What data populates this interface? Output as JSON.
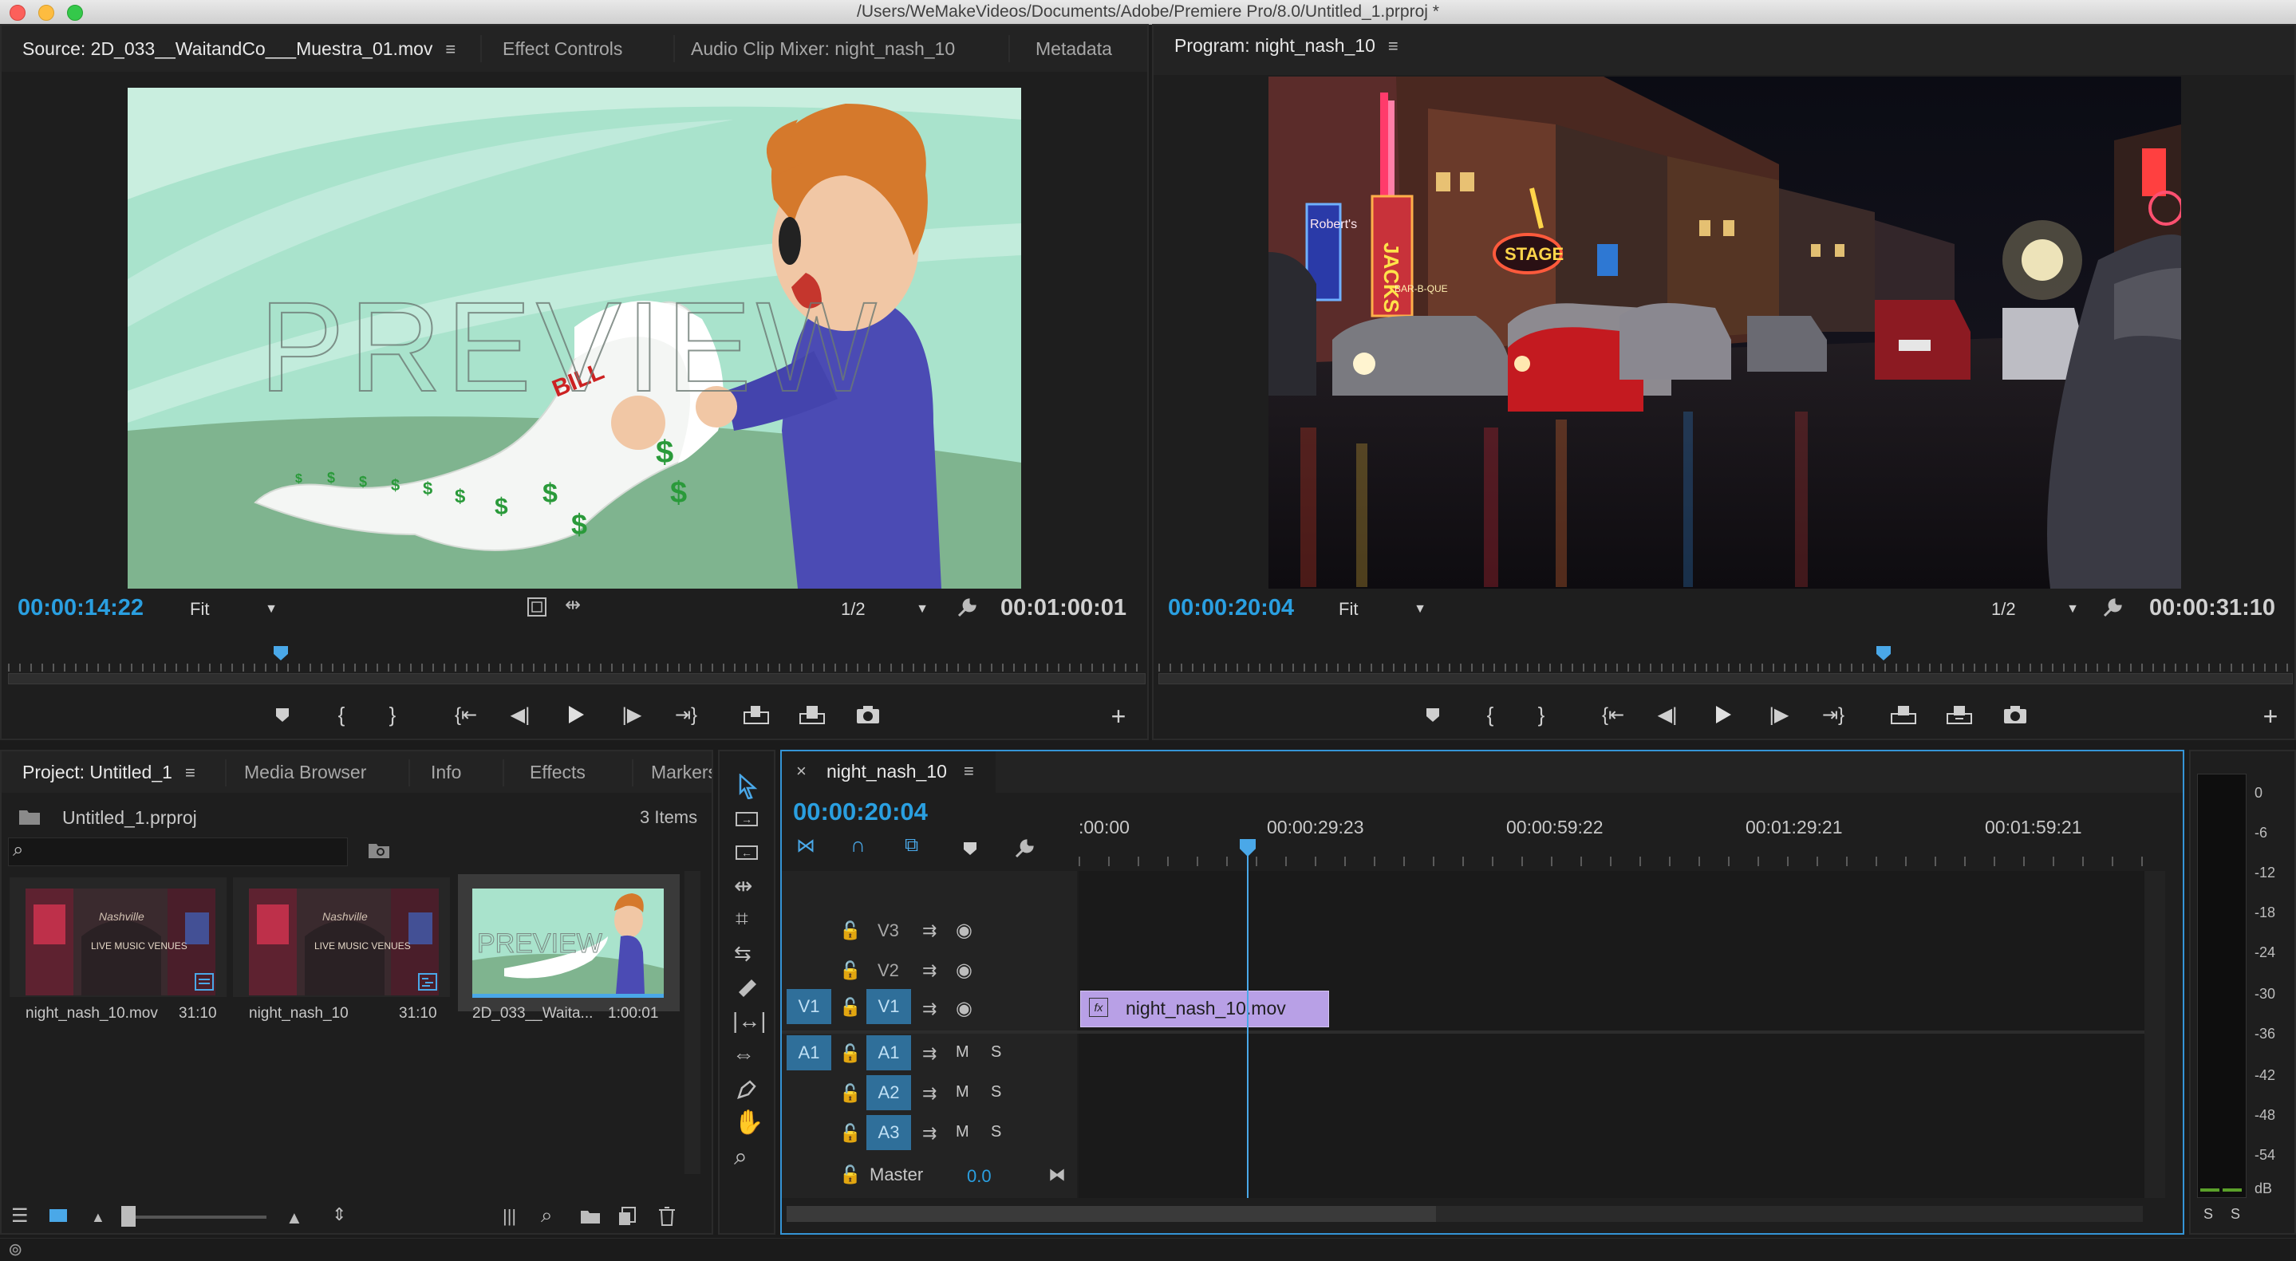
{
  "window": {
    "title": "/Users/WeMakeVideos/Documents/Adobe/Premiere Pro/8.0/Untitled_1.prproj *"
  },
  "source_panel": {
    "tabs": [
      "Source: 2D_033__WaitandCo___Muestra_01.mov",
      "Effect Controls",
      "Audio Clip Mixer: night_nash_10",
      "Metadata"
    ],
    "preview_text": "PREVIEW",
    "bill_text": "BILL",
    "timecode": "00:00:14:22",
    "fit": "Fit",
    "resolution": "1/2",
    "duration": "00:01:00:01",
    "playhead_fraction": 0.24
  },
  "program_panel": {
    "title": "Program: night_nash_10",
    "timecode": "00:00:20:04",
    "fit": "Fit",
    "resolution": "1/2",
    "duration": "00:00:31:10",
    "playhead_fraction": 0.64,
    "sign_text": [
      "JACKS",
      "BAR-B-QUE",
      "STAGE",
      "Robert's"
    ]
  },
  "project_panel": {
    "tabs": [
      "Project: Untitled_1",
      "Media Browser",
      "Info",
      "Effects",
      "Markers"
    ],
    "file": "Untitled_1.prproj",
    "count": "3 Items",
    "thumb_sign": "LIVE MUSIC VENUES",
    "thumb_script": "Nashville",
    "items": [
      {
        "name": "night_nash_10.mov",
        "duration": "31:10"
      },
      {
        "name": "night_nash_10",
        "duration": "31:10"
      },
      {
        "name": "2D_033__Waita...",
        "duration": "1:00:01"
      }
    ]
  },
  "timeline": {
    "tab": "night_nash_10",
    "timecode": "00:00:20:04",
    "ruler": [
      ":00:00",
      "00:00:29:23",
      "00:00:59:22",
      "00:01:29:21",
      "00:01:59:21"
    ],
    "video_tracks": [
      "V3",
      "V2",
      "V1"
    ],
    "audio_tracks": [
      "A1",
      "A2",
      "A3"
    ],
    "source_v": "V1",
    "source_a": "A1",
    "mute": "M",
    "solo": "S",
    "master_label": "Master",
    "master_value": "0.0",
    "clip": "night_nash_10.mov",
    "clip_fx": "fx"
  },
  "meter": {
    "labels": [
      "0",
      "-6",
      "-12",
      "-18",
      "-24",
      "-30",
      "-36",
      "-42",
      "-48",
      "-54",
      "dB"
    ],
    "solo": [
      "S",
      "S"
    ]
  },
  "colors": {
    "accent": "#2a9fe0",
    "clip": "#b8a0e6"
  }
}
